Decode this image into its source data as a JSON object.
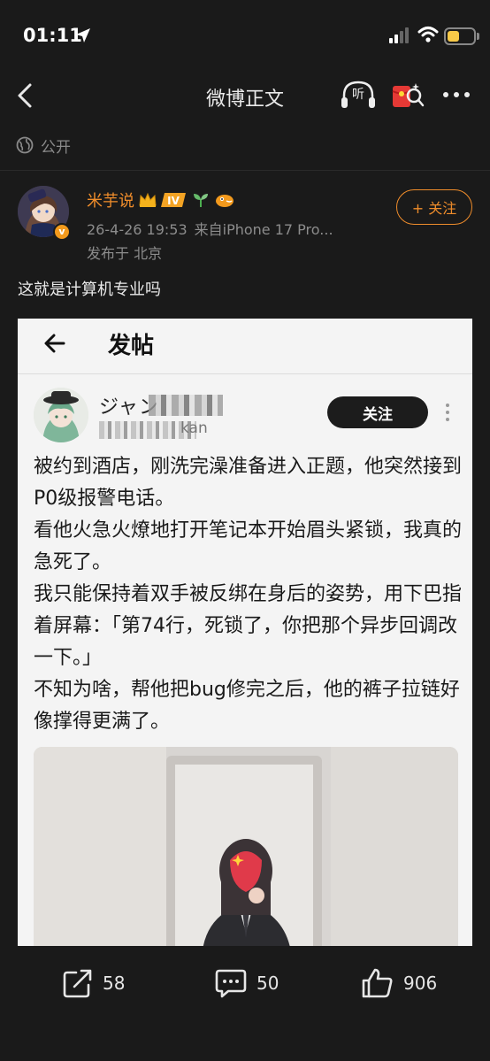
{
  "status_bar": {
    "time": "01:11"
  },
  "nav": {
    "title": "微博正文",
    "listen_label": "听"
  },
  "visibility": {
    "label": "公开"
  },
  "author": {
    "name": "米芋说",
    "level_badge": "IV",
    "timestamp": "26-4-26 19:53",
    "source": "来自iPhone 17 Pro...",
    "location": "发布于 北京",
    "follow_label": "+ 关注",
    "verified_badge": "v"
  },
  "post": {
    "text": "这就是计算机专业吗"
  },
  "embedded": {
    "title": "发帖",
    "follow_label": "关注",
    "name_visible": "ジャン",
    "handle_visible": "kan",
    "body": [
      "被约到酒店，刚洗完澡准备进入正题，他突然接到P0级报警电话。",
      "看他火急火燎地打开笔记本开始眉头紧锁，我真的急死了。",
      "我只能保持着双手被反绑在身后的姿势，用下巴指着屏幕：「第74行，死锁了，你把那个异步回调改一下。」",
      "不知为啥，帮他把bug修完之后，他的裤子拉链好像撑得更满了。"
    ]
  },
  "actions": {
    "share_count": "58",
    "comment_count": "50",
    "like_count": "906"
  },
  "colors": {
    "accent": "#f08d2b",
    "background": "#1a1a1a",
    "battery": "#f7c948"
  },
  "status_indicators": {
    "battery_fraction": 0.45
  }
}
